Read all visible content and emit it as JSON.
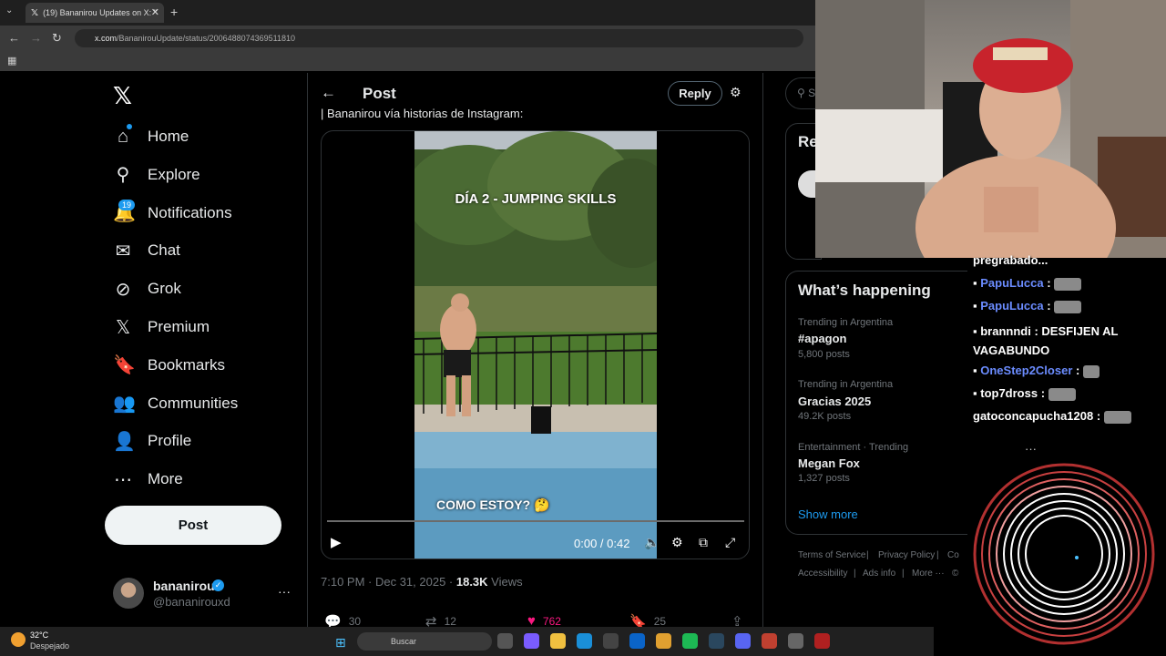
{
  "browser": {
    "tab_title": "(19) Bananirou Updates on X: \"",
    "url_host": "x.com",
    "url_path": "/BananirouUpdate/status/2006488074369511810"
  },
  "nav": {
    "items": [
      {
        "label": "Home",
        "icon": "home-icon"
      },
      {
        "label": "Explore",
        "icon": "search-icon"
      },
      {
        "label": "Notifications",
        "icon": "bell-icon"
      },
      {
        "label": "Chat",
        "icon": "mail-icon"
      },
      {
        "label": "Grok",
        "icon": "grok-icon"
      },
      {
        "label": "Premium",
        "icon": "x-icon"
      },
      {
        "label": "Bookmarks",
        "icon": "bookmark-icon"
      },
      {
        "label": "Communities",
        "icon": "people-icon"
      },
      {
        "label": "Profile",
        "icon": "person-icon"
      },
      {
        "label": "More",
        "icon": "more-circle-icon"
      }
    ],
    "notifications_badge": "19",
    "post_label": "Post"
  },
  "account": {
    "name": "bananirou",
    "handle": "@bananirouxd"
  },
  "post": {
    "header_title": "Post",
    "reply_label": "Reply",
    "caption": "| Bananirou vía historias de Instagram:",
    "video_text_top": "DÍA 2 - JUMPING SKILLS",
    "video_text_bottom": "COMO ESTOY? 🤔",
    "video_time": "0:00 / 0:42",
    "timestamp": "7:10 PM · Dec 31, 2025 · ",
    "views_count": "18.3K",
    "views_label": " Views",
    "replies": "30",
    "reposts": "12",
    "likes": "762",
    "bookmarks": "25"
  },
  "sidebar": {
    "search_placeholder": "S",
    "relevant_title": "Re",
    "happening_title": "What’s happening",
    "trends": [
      {
        "context": "Trending in Argentina",
        "name": "#apagon",
        "count": "5,800 posts"
      },
      {
        "context": "Trending in Argentina",
        "name": "Gracias 2025",
        "count": "49.2K posts"
      },
      {
        "context": "Entertainment · Trending",
        "name": "Megan Fox",
        "count": "1,327 posts"
      }
    ],
    "show_more": "Show more",
    "footer": [
      "Terms of Service",
      "|",
      "Privacy Policy",
      "|",
      "Co",
      "Accessibility",
      "|",
      "Ads info",
      "|",
      "More ···",
      "©"
    ]
  },
  "stream_chat": {
    "partial_line": "pregrabado...",
    "lines": [
      {
        "user": "PapuLucca",
        "message": ":"
      },
      {
        "user": "PapuLucca",
        "message": ":"
      },
      {
        "user": "brannndi",
        "message": ": DESFIJEN AL VAGABUNDO"
      },
      {
        "user": "OneStep2Closer",
        "message": ":"
      },
      {
        "user": "top7dross",
        "message": ":"
      },
      {
        "user": "gatoconcapucha1208",
        "message": ":"
      }
    ],
    "more": "···"
  },
  "taskbar": {
    "weather_temp": "32°C",
    "weather_desc": "Despejado",
    "search_label": "Buscar"
  },
  "colors": {
    "accent": "#1d9bf0",
    "like": "#f91880",
    "background": "#000000"
  }
}
